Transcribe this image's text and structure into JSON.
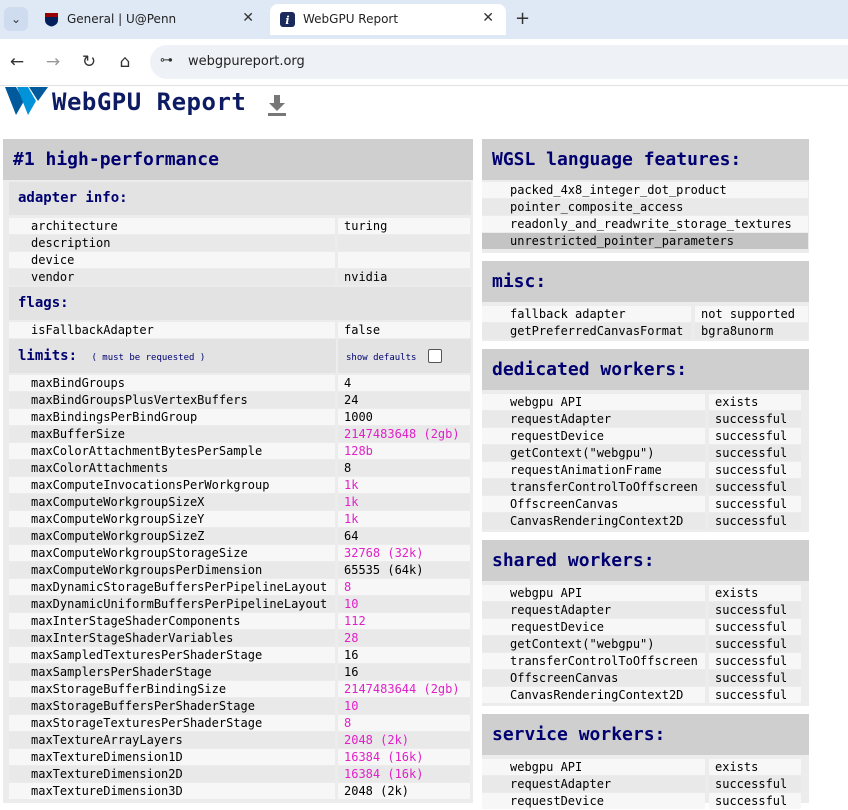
{
  "browser": {
    "tabs": [
      {
        "title": "General | U@Penn",
        "close": "✕"
      },
      {
        "title": "WebGPU Report",
        "close": "✕"
      }
    ],
    "new_tab": "+",
    "url": "webgpureport.org"
  },
  "page": {
    "title": "WebGPU Report"
  },
  "adapter": {
    "heading": "#1 high-performance",
    "info_title": "adapter info:",
    "info": [
      {
        "k": "architecture",
        "v": "turing"
      },
      {
        "k": "description",
        "v": ""
      },
      {
        "k": "device",
        "v": ""
      },
      {
        "k": "vendor",
        "v": "nvidia"
      }
    ],
    "flags_title": "flags:",
    "flags": [
      {
        "k": "isFallbackAdapter",
        "v": "false"
      }
    ],
    "limits_title": "limits:",
    "limits_note": "( must be requested )",
    "show_defaults": "show defaults",
    "limits": [
      {
        "k": "maxBindGroups",
        "v": "4",
        "hl": false
      },
      {
        "k": "maxBindGroupsPlusVertexBuffers",
        "v": "24",
        "hl": false
      },
      {
        "k": "maxBindingsPerBindGroup",
        "v": "1000",
        "hl": false
      },
      {
        "k": "maxBufferSize",
        "v": "2147483648 (2gb)",
        "hl": true
      },
      {
        "k": "maxColorAttachmentBytesPerSample",
        "v": "128b",
        "hl": true
      },
      {
        "k": "maxColorAttachments",
        "v": "8",
        "hl": false
      },
      {
        "k": "maxComputeInvocationsPerWorkgroup",
        "v": "1k",
        "hl": true
      },
      {
        "k": "maxComputeWorkgroupSizeX",
        "v": "1k",
        "hl": true
      },
      {
        "k": "maxComputeWorkgroupSizeY",
        "v": "1k",
        "hl": true
      },
      {
        "k": "maxComputeWorkgroupSizeZ",
        "v": "64",
        "hl": false
      },
      {
        "k": "maxComputeWorkgroupStorageSize",
        "v": "32768 (32k)",
        "hl": true
      },
      {
        "k": "maxComputeWorkgroupsPerDimension",
        "v": "65535 (64k)",
        "hl": false
      },
      {
        "k": "maxDynamicStorageBuffersPerPipelineLayout",
        "v": "8",
        "hl": true
      },
      {
        "k": "maxDynamicUniformBuffersPerPipelineLayout",
        "v": "10",
        "hl": true
      },
      {
        "k": "maxInterStageShaderComponents",
        "v": "112",
        "hl": true
      },
      {
        "k": "maxInterStageShaderVariables",
        "v": "28",
        "hl": true
      },
      {
        "k": "maxSampledTexturesPerShaderStage",
        "v": "16",
        "hl": false
      },
      {
        "k": "maxSamplersPerShaderStage",
        "v": "16",
        "hl": false
      },
      {
        "k": "maxStorageBufferBindingSize",
        "v": "2147483644 (2gb)",
        "hl": true
      },
      {
        "k": "maxStorageBuffersPerShaderStage",
        "v": "10",
        "hl": true
      },
      {
        "k": "maxStorageTexturesPerShaderStage",
        "v": "8",
        "hl": true
      },
      {
        "k": "maxTextureArrayLayers",
        "v": "2048 (2k)",
        "hl": true
      },
      {
        "k": "maxTextureDimension1D",
        "v": "16384 (16k)",
        "hl": true
      },
      {
        "k": "maxTextureDimension2D",
        "v": "16384 (16k)",
        "hl": true
      },
      {
        "k": "maxTextureDimension3D",
        "v": "2048 (2k)",
        "hl": false
      }
    ]
  },
  "wgsl": {
    "heading": "WGSL language features:",
    "items": [
      "packed_4x8_integer_dot_product",
      "pointer_composite_access",
      "readonly_and_readwrite_storage_textures",
      "unrestricted_pointer_parameters"
    ]
  },
  "misc": {
    "heading": "misc:",
    "rows": [
      {
        "k": "fallback adapter",
        "v": "not supported"
      },
      {
        "k": "getPreferredCanvasFormat",
        "v": "bgra8unorm"
      }
    ]
  },
  "dedicated": {
    "heading": "dedicated workers:",
    "rows": [
      {
        "k": "webgpu API",
        "v": "exists"
      },
      {
        "k": "requestAdapter",
        "v": "successful"
      },
      {
        "k": "requestDevice",
        "v": "successful"
      },
      {
        "k": "getContext(\"webgpu\")",
        "v": "successful"
      },
      {
        "k": "requestAnimationFrame",
        "v": "successful"
      },
      {
        "k": "transferControlToOffscreen",
        "v": "successful"
      },
      {
        "k": "OffscreenCanvas",
        "v": "successful"
      },
      {
        "k": "CanvasRenderingContext2D",
        "v": "successful"
      }
    ]
  },
  "shared": {
    "heading": "shared workers:",
    "rows": [
      {
        "k": "webgpu API",
        "v": "exists"
      },
      {
        "k": "requestAdapter",
        "v": "successful"
      },
      {
        "k": "requestDevice",
        "v": "successful"
      },
      {
        "k": "getContext(\"webgpu\")",
        "v": "successful"
      },
      {
        "k": "transferControlToOffscreen",
        "v": "successful"
      },
      {
        "k": "OffscreenCanvas",
        "v": "successful"
      },
      {
        "k": "CanvasRenderingContext2D",
        "v": "successful"
      }
    ]
  },
  "service": {
    "heading": "service workers:",
    "rows": [
      {
        "k": "webgpu API",
        "v": "exists"
      },
      {
        "k": "requestAdapter",
        "v": "successful"
      },
      {
        "k": "requestDevice",
        "v": "successful"
      }
    ]
  }
}
